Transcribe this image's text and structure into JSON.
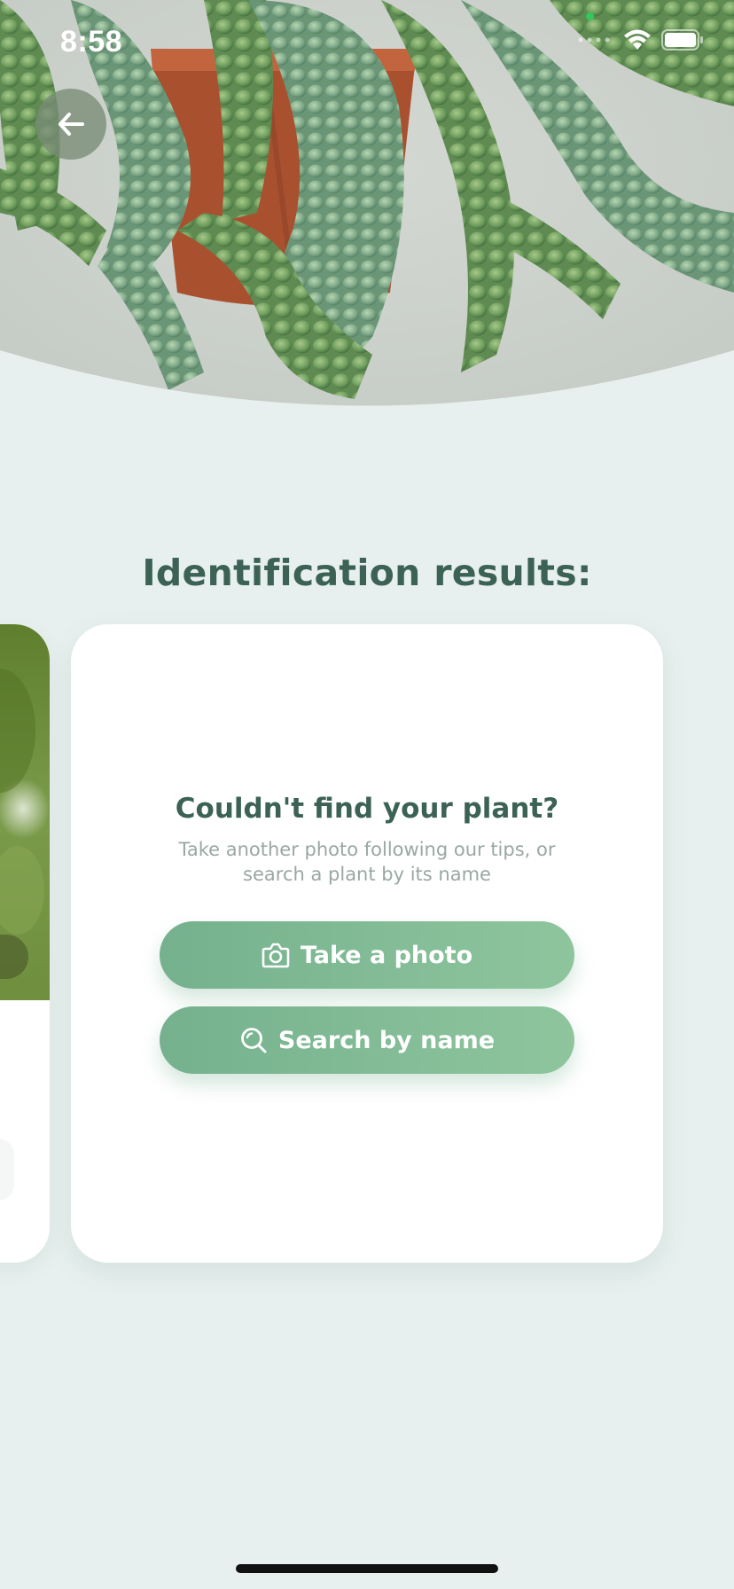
{
  "status_bar": {
    "time": "8:58"
  },
  "header": {
    "back_icon": "arrow-left-icon"
  },
  "results": {
    "title": "Identification results:"
  },
  "not_found_card": {
    "heading": "Couldn't find your plant?",
    "subtext": "Take another photo following our tips, or search a plant by its name",
    "take_photo_label": "Take a photo",
    "take_photo_icon": "camera-icon",
    "search_label": "Search by name",
    "search_icon": "search-icon"
  },
  "colors": {
    "background": "#e7f0ee",
    "title_text": "#3c6255",
    "subtext": "#9aa7a2",
    "button_start": "#75b18e",
    "button_end": "#8ec59d",
    "card": "#ffffff"
  }
}
